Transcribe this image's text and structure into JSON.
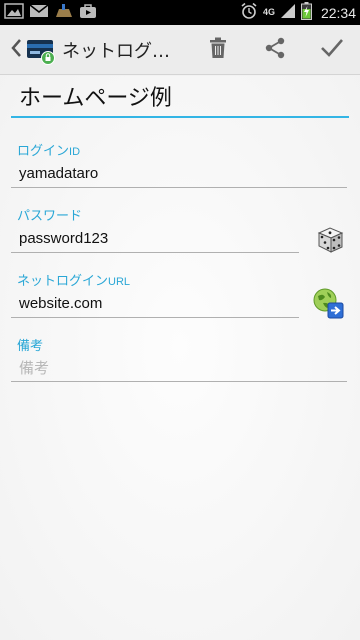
{
  "status_bar": {
    "time": "22:34",
    "network": "4G"
  },
  "action_bar": {
    "title": "ネットログイン…",
    "icons": [
      "back-icon",
      "app-card-icon",
      "trash-icon",
      "share-icon",
      "check-icon"
    ]
  },
  "form": {
    "title": "ホームページ例",
    "login_id": {
      "label": "ログイン",
      "label_suffix": "ID",
      "value": "yamadataro"
    },
    "password": {
      "label": "パスワード",
      "value": "password123"
    },
    "url": {
      "label": "ネットログイン",
      "label_suffix": "URL",
      "value": "website.com"
    },
    "note": {
      "label": "備考",
      "placeholder": "備考"
    }
  },
  "colors": {
    "accent": "#33b5e5",
    "label": "#2aa7d6",
    "status_bar": "#000000",
    "action_bar": "#ececec"
  }
}
